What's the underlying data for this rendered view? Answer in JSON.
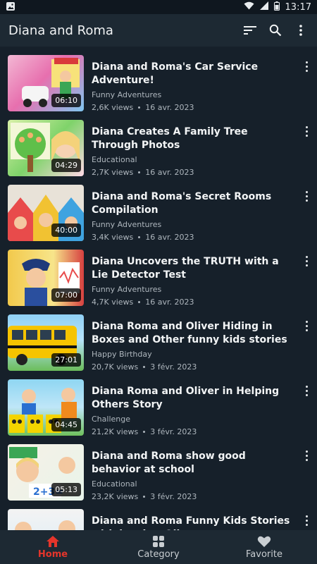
{
  "status_bar": {
    "time": "13:17"
  },
  "app_bar": {
    "title": "Diana and Roma"
  },
  "videos": [
    {
      "title": "Diana and Roma's Car Service Adventure!",
      "category": "Funny Adventures",
      "views": "2,6K views",
      "date": "16 avr. 2023",
      "duration": "06:10"
    },
    {
      "title": "Diana Creates A Family Tree Through Photos",
      "category": "Educational",
      "views": "2,7K views",
      "date": "16 avr. 2023",
      "duration": "04:29"
    },
    {
      "title": "Diana and Roma's Secret Rooms Compilation",
      "category": "Funny Adventures",
      "views": "3,4K views",
      "date": "16 avr. 2023",
      "duration": "40:00"
    },
    {
      "title": "Diana Uncovers the TRUTH with a Lie Detector Test",
      "category": "Funny Adventures",
      "views": "4,7K views",
      "date": "16 avr. 2023",
      "duration": "07:00"
    },
    {
      "title": "Diana Roma and Oliver Hiding in Boxes and Other funny kids stories",
      "category": "Happy Birthday",
      "views": "20,7K views",
      "date": "3 févr. 2023",
      "duration": "27:01"
    },
    {
      "title": "Diana Roma and Oliver in Helping Others Story",
      "category": "Challenge",
      "views": "21,2K views",
      "date": "3 févr. 2023",
      "duration": "04:45"
    },
    {
      "title": "Diana and Roma show good behavior at school",
      "category": "Educational",
      "views": "23,2K views",
      "date": "3 févr. 2023",
      "duration": "05:13"
    },
    {
      "title": "Diana and Roma Funny Kids Stories with brother Oliver",
      "category": "",
      "views": "",
      "date": "",
      "duration": ""
    }
  ],
  "bottom_nav": [
    {
      "label": "Home",
      "icon": "home-icon"
    },
    {
      "label": "Category",
      "icon": "grid-icon"
    },
    {
      "label": "Favorite",
      "icon": "heart-icon"
    }
  ],
  "colors": {
    "accent": "#e5352b",
    "background": "#16202a",
    "bar": "#1d2933"
  }
}
